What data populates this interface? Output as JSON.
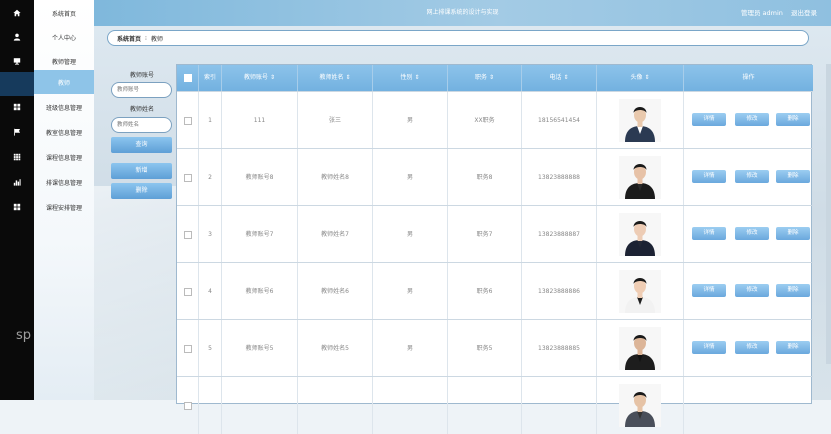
{
  "app": {
    "title": "网上排课系统的设计与实现",
    "user_label": "管理员 admin",
    "logout_label": "退出登录",
    "faint_text": "sp"
  },
  "sidebar": {
    "items": [
      {
        "label": "系统首页",
        "icon": "home-icon"
      },
      {
        "label": "个人中心",
        "icon": "user-icon"
      },
      {
        "label": "教师管理",
        "icon": "monitor-icon"
      },
      {
        "label": "教师",
        "icon": "",
        "active": true
      },
      {
        "label": "班级信息管理",
        "icon": "grid-icon"
      },
      {
        "label": "教室信息管理",
        "icon": "flag-icon"
      },
      {
        "label": "课程信息管理",
        "icon": "table-icon"
      },
      {
        "label": "排课信息管理",
        "icon": "bar-chart-icon"
      },
      {
        "label": "课程安排管理",
        "icon": "grid-icon"
      }
    ]
  },
  "breadcrumb": {
    "home": "系统首页",
    "separator": "⁝",
    "current": "教师"
  },
  "search": {
    "account_label": "教师账号",
    "account_placeholder": "教师账号",
    "name_label": "教师姓名",
    "name_placeholder": "教师姓名",
    "query_button": "查询",
    "add_button": "新增",
    "delete_button": "删除"
  },
  "table": {
    "columns": [
      "",
      "索引",
      "教师账号 ⇕",
      "教师姓名 ⇕",
      "性别 ⇕",
      "职务 ⇕",
      "电话 ⇕",
      "头像 ⇕",
      "操作"
    ],
    "actions": {
      "detail": "详情",
      "edit": "修改",
      "delete": "删除"
    },
    "rows": [
      {
        "index": "1",
        "account": "111",
        "name": "张三",
        "gender": "男",
        "title": "XX职务",
        "phone": "18156541454"
      },
      {
        "index": "2",
        "account": "教师账号8",
        "name": "教师姓名8",
        "gender": "男",
        "title": "职务8",
        "phone": "13823888888"
      },
      {
        "index": "3",
        "account": "教师账号7",
        "name": "教师姓名7",
        "gender": "男",
        "title": "职务7",
        "phone": "13823888887"
      },
      {
        "index": "4",
        "account": "教师账号6",
        "name": "教师姓名6",
        "gender": "男",
        "title": "职务6",
        "phone": "13823888886"
      },
      {
        "index": "5",
        "account": "教师账号5",
        "name": "教师姓名5",
        "gender": "男",
        "title": "职务5",
        "phone": "13823888885"
      },
      {
        "index": "",
        "account": "",
        "name": "",
        "gender": "",
        "title": "",
        "phone": ""
      }
    ]
  },
  "colors": {
    "accent": "#73b1e0",
    "rail": "#0a0a0a",
    "menu_active": "#8ec4e8"
  }
}
